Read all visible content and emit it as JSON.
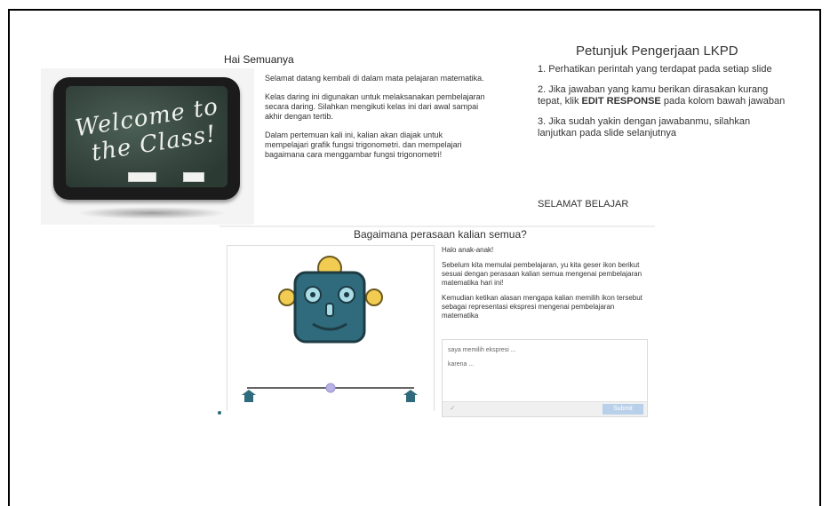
{
  "greeting": "Hai Semuanya",
  "intro": {
    "p1": "Selamat datang kembali di dalam mata pelajaran matematika.",
    "p2": "Kelas daring ini digunakan untuk melaksanakan pembelajaran secara daring. Silahkan mengikuti kelas ini dari awal sampai akhir dengan tertib.",
    "p3": "Dalam pertemuan kali ini, kalian akan diajak untuk mempelajari grafik fungsi trigonometri. dan mempelajari bagaimana cara menggambar fungsi trigonometri!"
  },
  "board": {
    "line1": "Welcome to",
    "line2": "the Class!"
  },
  "instructions": {
    "title": "Petunjuk Pengerjaan LKPD",
    "step1": "1. Perhatikan perintah yang terdapat pada setiap slide",
    "step2_pre": "2. Jika jawaban yang kamu berikan dirasakan kurang tepat, klik ",
    "step2_bold": "EDIT RESPONSE",
    "step2_post": " pada kolom bawah jawaban",
    "step3": "3. Jika sudah yakin dengan jawabanmu, silahkan lanjutkan pada slide selanjutnya",
    "closing": "SELAMAT BELAJAR"
  },
  "question": "Bagaimana perasaan kalian semua?",
  "activity": {
    "p1": "Halo anak-anak!",
    "p2": "Sebelum kita memulai pembelajaran, yu kita geser ikon berikut sesuai dengan perasaan kalian semua mengenai pembelajaran matematika hari ini!",
    "p3": "Kemudian ketikan alasan mengapa kalian memilih ikon tersebut sebagai representasi ekspresi mengenai pembelajaran matematika"
  },
  "response": {
    "line1": "saya memilih ekspresi ...",
    "line2": "karena ...",
    "submit_label": "Submit"
  },
  "slider_value": 0.5,
  "colors": {
    "robot_face": "#2f6b7c",
    "robot_gold": "#f2cc52",
    "slider_handle": "#b9b2e6",
    "submit": "#b8d0ea"
  }
}
